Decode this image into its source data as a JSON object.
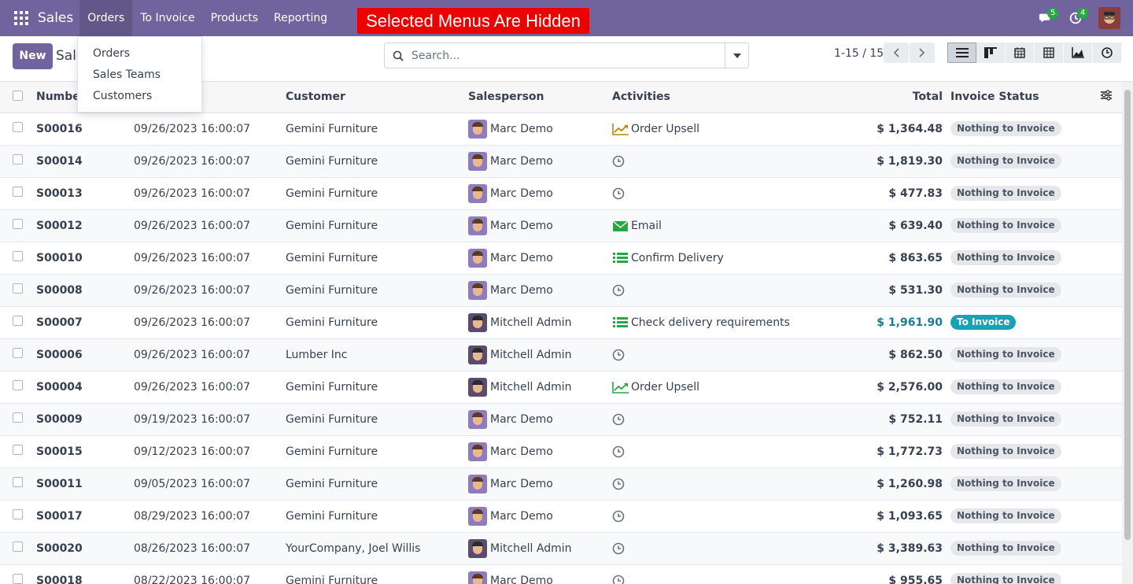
{
  "navbar": {
    "app_name": "Sales",
    "menu": [
      "Orders",
      "To Invoice",
      "Products",
      "Reporting"
    ],
    "banner": "Selected Menus Are Hidden",
    "chat_badge": "5",
    "activity_badge": "4"
  },
  "dropdown": [
    "Orders",
    "Sales Teams",
    "Customers"
  ],
  "control": {
    "new_label": "New",
    "breadcrumb": "Sale",
    "search_placeholder": "Search...",
    "pager": "1-15 / 15"
  },
  "columns": {
    "number": "Number",
    "customer": "Customer",
    "salesperson": "Salesperson",
    "activities": "Activities",
    "total": "Total",
    "invoice_status": "Invoice Status"
  },
  "rows": [
    {
      "number": "S00016",
      "date": "09/26/2023 16:00:07",
      "customer": "Gemini Furniture",
      "salesperson": "Marc Demo",
      "avatar": "marc",
      "activity": "Order Upsell",
      "activity_icon": "upsell-icon",
      "total": "$ 1,364.48",
      "status": "Nothing to Invoice"
    },
    {
      "number": "S00014",
      "date": "09/26/2023 16:00:07",
      "customer": "Gemini Furniture",
      "salesperson": "Marc Demo",
      "avatar": "marc",
      "activity": "",
      "activity_icon": "clock-icon",
      "total": "$ 1,819.30",
      "status": "Nothing to Invoice"
    },
    {
      "number": "S00013",
      "date": "09/26/2023 16:00:07",
      "customer": "Gemini Furniture",
      "salesperson": "Marc Demo",
      "avatar": "marc",
      "activity": "",
      "activity_icon": "clock-icon",
      "total": "$ 477.83",
      "status": "Nothing to Invoice"
    },
    {
      "number": "S00012",
      "date": "09/26/2023 16:00:07",
      "customer": "Gemini Furniture",
      "salesperson": "Marc Demo",
      "avatar": "marc",
      "activity": "Email",
      "activity_icon": "email-icon",
      "total": "$ 639.40",
      "status": "Nothing to Invoice"
    },
    {
      "number": "S00010",
      "date": "09/26/2023 16:00:07",
      "customer": "Gemini Furniture",
      "salesperson": "Marc Demo",
      "avatar": "marc",
      "activity": "Confirm Delivery",
      "activity_icon": "tasks-icon",
      "total": "$ 863.65",
      "status": "Nothing to Invoice"
    },
    {
      "number": "S00008",
      "date": "09/26/2023 16:00:07",
      "customer": "Gemini Furniture",
      "salesperson": "Marc Demo",
      "avatar": "marc",
      "activity": "",
      "activity_icon": "clock-icon",
      "total": "$ 531.30",
      "status": "Nothing to Invoice"
    },
    {
      "number": "S00007",
      "date": "09/26/2023 16:00:07",
      "customer": "Gemini Furniture",
      "salesperson": "Mitchell Admin",
      "avatar": "mitch",
      "activity": "Check delivery requirements",
      "activity_icon": "tasks-icon",
      "total": "$ 1,961.90",
      "status": "To Invoice"
    },
    {
      "number": "S00006",
      "date": "09/26/2023 16:00:07",
      "customer": "Lumber Inc",
      "salesperson": "Mitchell Admin",
      "avatar": "mitch",
      "activity": "",
      "activity_icon": "clock-icon",
      "total": "$ 862.50",
      "status": "Nothing to Invoice"
    },
    {
      "number": "S00004",
      "date": "09/26/2023 16:00:07",
      "customer": "Gemini Furniture",
      "salesperson": "Mitchell Admin",
      "avatar": "mitch",
      "activity": "Order Upsell",
      "activity_icon": "upsell-icon-green",
      "total": "$ 2,576.00",
      "status": "Nothing to Invoice"
    },
    {
      "number": "S00009",
      "date": "09/19/2023 16:00:07",
      "customer": "Gemini Furniture",
      "salesperson": "Marc Demo",
      "avatar": "marc",
      "activity": "",
      "activity_icon": "clock-icon",
      "total": "$ 752.11",
      "status": "Nothing to Invoice"
    },
    {
      "number": "S00015",
      "date": "09/12/2023 16:00:07",
      "customer": "Gemini Furniture",
      "salesperson": "Marc Demo",
      "avatar": "marc",
      "activity": "",
      "activity_icon": "clock-icon",
      "total": "$ 1,772.73",
      "status": "Nothing to Invoice"
    },
    {
      "number": "S00011",
      "date": "09/05/2023 16:00:07",
      "customer": "Gemini Furniture",
      "salesperson": "Marc Demo",
      "avatar": "marc",
      "activity": "",
      "activity_icon": "clock-icon",
      "total": "$ 1,260.98",
      "status": "Nothing to Invoice"
    },
    {
      "number": "S00017",
      "date": "08/29/2023 16:00:07",
      "customer": "Gemini Furniture",
      "salesperson": "Marc Demo",
      "avatar": "marc",
      "activity": "",
      "activity_icon": "clock-icon",
      "total": "$ 1,093.65",
      "status": "Nothing to Invoice"
    },
    {
      "number": "S00020",
      "date": "08/26/2023 16:00:07",
      "customer": "YourCompany, Joel Willis",
      "salesperson": "Mitchell Admin",
      "avatar": "mitch",
      "activity": "",
      "activity_icon": "clock-icon",
      "total": "$ 3,389.63",
      "status": "Nothing to Invoice"
    },
    {
      "number": "S00018",
      "date": "08/22/2023 16:00:07",
      "customer": "Gemini Furniture",
      "salesperson": "Marc Demo",
      "avatar": "marc",
      "activity": "",
      "activity_icon": "clock-icon",
      "total": "$ 955.65",
      "status": "Nothing to Invoice"
    }
  ],
  "colors": {
    "navbar": "#71639e",
    "banner": "#ee0000",
    "upsell": "#b8860b",
    "green": "#28a745",
    "to_invoice": "#17a2b8"
  }
}
